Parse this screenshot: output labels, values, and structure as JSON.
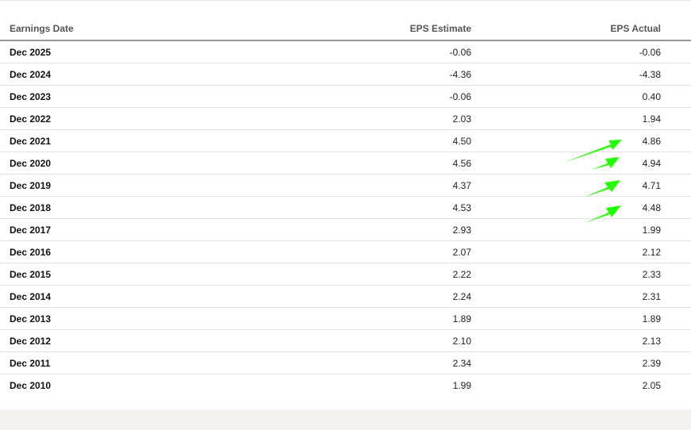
{
  "table": {
    "headers": {
      "date": "Earnings Date",
      "estimate": "EPS Estimate",
      "actual": "EPS Actual"
    },
    "rows": [
      {
        "date": "Dec 2025",
        "estimate": "-0.06",
        "actual": "-0.06"
      },
      {
        "date": "Dec 2024",
        "estimate": "-4.36",
        "actual": "-4.38"
      },
      {
        "date": "Dec 2023",
        "estimate": "-0.06",
        "actual": "0.40"
      },
      {
        "date": "Dec 2022",
        "estimate": "2.03",
        "actual": "1.94"
      },
      {
        "date": "Dec 2021",
        "estimate": "4.50",
        "actual": "4.86"
      },
      {
        "date": "Dec 2020",
        "estimate": "4.56",
        "actual": "4.94"
      },
      {
        "date": "Dec 2019",
        "estimate": "4.37",
        "actual": "4.71"
      },
      {
        "date": "Dec 2018",
        "estimate": "4.53",
        "actual": "4.48"
      },
      {
        "date": "Dec 2017",
        "estimate": "2.93",
        "actual": "1.99"
      },
      {
        "date": "Dec 2016",
        "estimate": "2.07",
        "actual": "2.12"
      },
      {
        "date": "Dec 2015",
        "estimate": "2.22",
        "actual": "2.33"
      },
      {
        "date": "Dec 2014",
        "estimate": "2.24",
        "actual": "2.31"
      },
      {
        "date": "Dec 2013",
        "estimate": "1.89",
        "actual": "1.89"
      },
      {
        "date": "Dec 2012",
        "estimate": "2.10",
        "actual": "2.13"
      },
      {
        "date": "Dec 2011",
        "estimate": "2.34",
        "actual": "2.39"
      },
      {
        "date": "Dec 2010",
        "estimate": "1.99",
        "actual": "2.05"
      }
    ]
  },
  "annotations": {
    "arrow_color": "#22ff00",
    "highlighted_rows": [
      "Dec 2021",
      "Dec 2020",
      "Dec 2019",
      "Dec 2018"
    ]
  }
}
